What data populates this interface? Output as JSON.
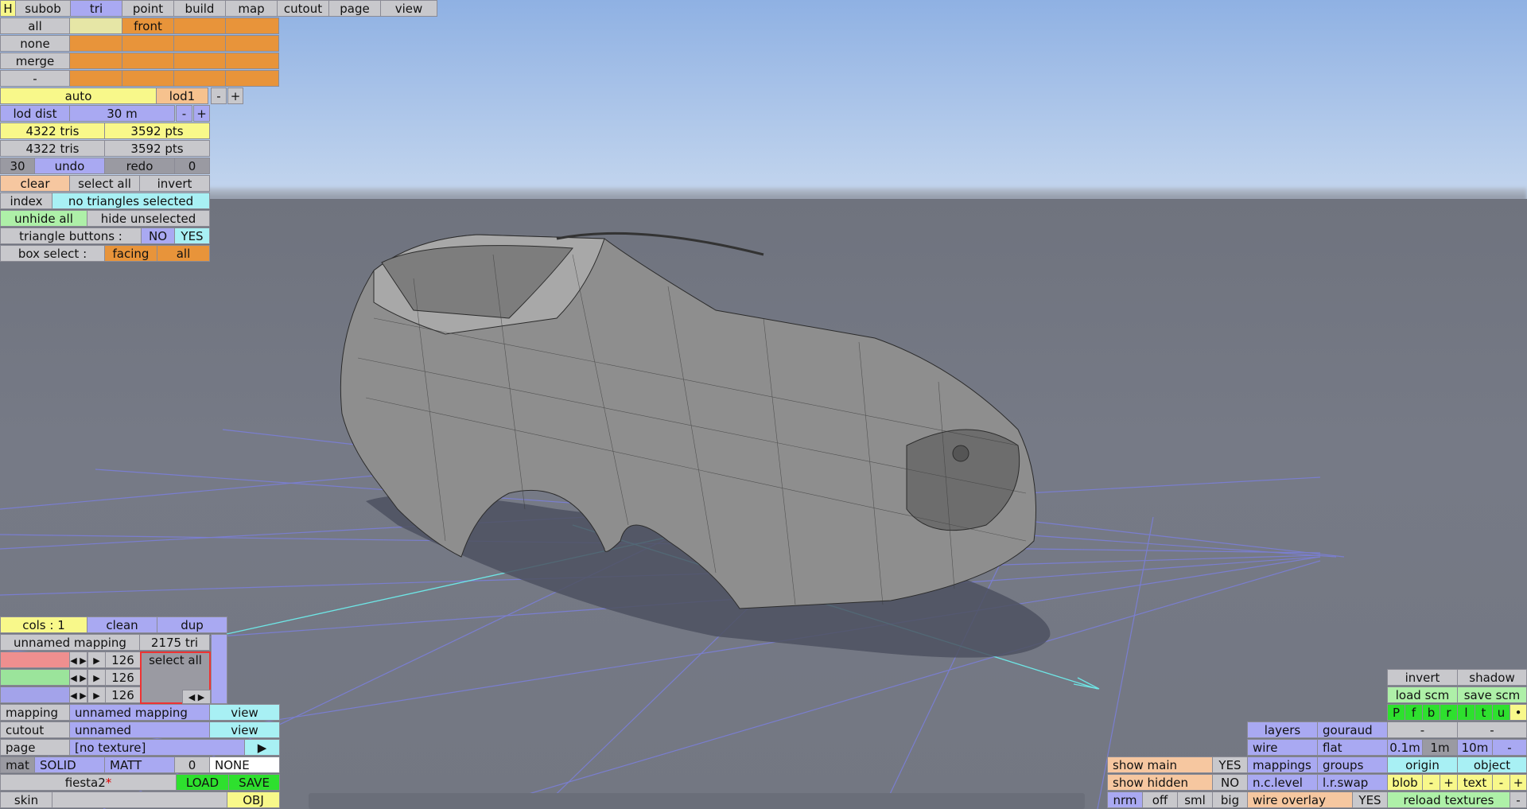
{
  "menu": {
    "h": "H",
    "tabs": [
      "subob",
      "tri",
      "point",
      "build",
      "map",
      "cutout",
      "page",
      "view"
    ]
  },
  "sel_panel": {
    "rows": [
      "all",
      "none",
      "merge",
      "-"
    ],
    "front": "front"
  },
  "lod": {
    "auto": "auto",
    "lod1": "lod1",
    "minus": "-",
    "plus": "+"
  },
  "lod_dist": {
    "label": "lod dist",
    "value": "30 m",
    "minus": "-",
    "plus": "+"
  },
  "stats": {
    "tris1": "4322 tris",
    "pts1": "3592 pts",
    "tris2": "4322 tris",
    "pts2": "3592 pts"
  },
  "history": {
    "count": "30",
    "undo": "undo",
    "redo": "redo",
    "redo_count": "0"
  },
  "select": {
    "clear": "clear",
    "select_all": "select all",
    "invert": "invert"
  },
  "index": {
    "label": "index",
    "value": "no triangles selected"
  },
  "hide": {
    "unhide_all": "unhide all",
    "hide_unselected": "hide unselected"
  },
  "tri_buttons": {
    "label": "triangle buttons :",
    "no": "NO",
    "yes": "YES"
  },
  "box_select": {
    "label": "box select :",
    "facing": "facing",
    "all": "all"
  },
  "mapping_panel": {
    "cols": "cols : 1",
    "clean": "clean",
    "dup": "dup",
    "name": "unnamed mapping",
    "tri_count": "2175 tri",
    "rgb": [
      "126",
      "126",
      "126"
    ],
    "select_all": "select all",
    "mapping_label": "mapping",
    "mapping_value": "unnamed mapping",
    "mapping_view": "view",
    "cutout_label": "cutout",
    "cutout_value": "unnamed",
    "cutout_view": "view",
    "page_label": "page",
    "page_value": "[no texture]",
    "mat": "mat",
    "solid": "SOLID",
    "matt": "MATT",
    "mat_num": "0",
    "none": "NONE",
    "file": "fiesta2",
    "file_mark": "*",
    "load": "LOAD",
    "save": "SAVE",
    "skin": "skin",
    "obj": "OBJ"
  },
  "view_panel": {
    "invert": "invert",
    "shadow": "shadow",
    "load_scm": "load scm",
    "save_scm": "save scm",
    "views": [
      "P",
      "f",
      "b",
      "r",
      "l",
      "t",
      "u",
      "•"
    ],
    "layers": "layers",
    "gouraud": "gouraud",
    "dash": "-",
    "wire": "wire",
    "flat": "flat",
    "grid": [
      "0.1m",
      "1m",
      "10m",
      "-"
    ],
    "show_main": "show main",
    "show_main_val": "YES",
    "mappings": "mappings",
    "groups": "groups",
    "origin": "origin",
    "object": "object",
    "show_hidden": "show hidden",
    "show_hidden_val": "NO",
    "nclevel": "n.c.level",
    "lrswap": "l.r.swap",
    "blob": "blob",
    "text": "text",
    "minus": "-",
    "plus": "+",
    "nrm": "nrm",
    "off": "off",
    "sml": "sml",
    "big": "big",
    "wire_overlay": "wire overlay",
    "wire_overlay_val": "YES",
    "reload": "reload textures"
  }
}
